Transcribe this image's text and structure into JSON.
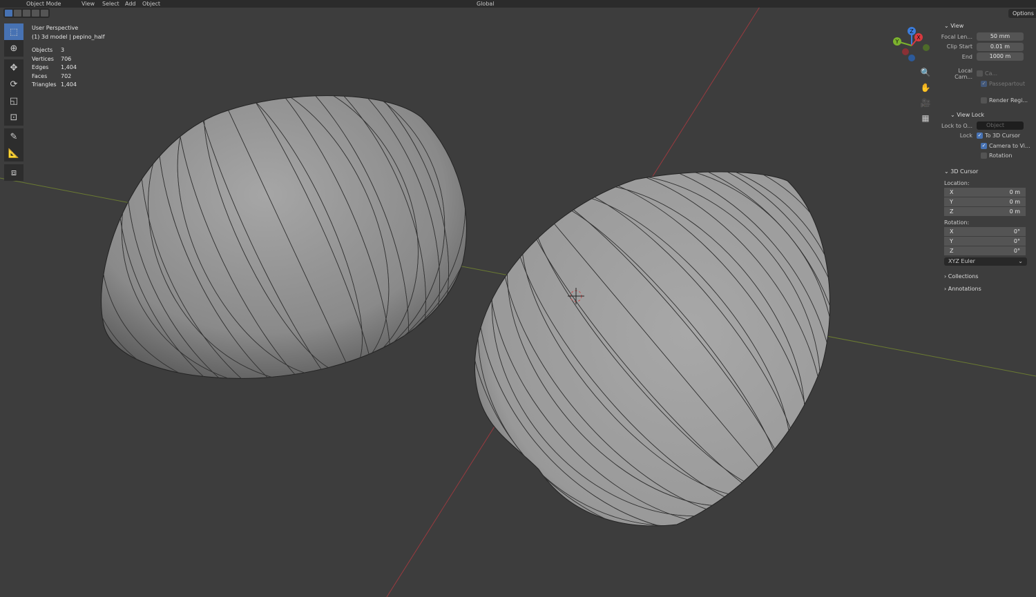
{
  "header": {
    "mode": "Object Mode",
    "menus": [
      "View",
      "Select",
      "Add",
      "Object"
    ],
    "orientation": "Global",
    "options_label": "Options"
  },
  "overlay": {
    "perspective": "User Perspective",
    "object_info": "(1) 3d model | pepino_half",
    "stats": [
      {
        "label": "Objects",
        "value": "3"
      },
      {
        "label": "Vertices",
        "value": "706"
      },
      {
        "label": "Edges",
        "value": "1,404"
      },
      {
        "label": "Faces",
        "value": "702"
      },
      {
        "label": "Triangles",
        "value": "1,404"
      }
    ]
  },
  "gizmo": {
    "x": "X",
    "y": "Y",
    "z": "Z"
  },
  "panel": {
    "view": {
      "title": "View",
      "focal_label": "Focal Len...",
      "focal": "50 mm",
      "clip_start_label": "Clip Start",
      "clip_start": "0.01 m",
      "end_label": "End",
      "end": "1000 m",
      "local_cam_label": "Local Cam...",
      "local_cam_value": "Ca...",
      "passepartout": "Passepartout",
      "render_region": "Render Regi..."
    },
    "view_lock": {
      "title": "View Lock",
      "lock_to_label": "Lock to O...",
      "lock_to_placeholder": "Object",
      "lock_label": "Lock",
      "to_cursor": "To 3D Cursor",
      "camera_to_view": "Camera to Vi...",
      "rotation": "Rotation"
    },
    "cursor": {
      "title": "3D Cursor",
      "location_label": "Location:",
      "loc": [
        {
          "axis": "X",
          "value": "0 m"
        },
        {
          "axis": "Y",
          "value": "0 m"
        },
        {
          "axis": "Z",
          "value": "0 m"
        }
      ],
      "rotation_label": "Rotation:",
      "rot": [
        {
          "axis": "X",
          "value": "0°"
        },
        {
          "axis": "Y",
          "value": "0°"
        },
        {
          "axis": "Z",
          "value": "0°"
        }
      ],
      "mode": "XYZ Euler"
    },
    "collections": "Collections",
    "annotations": "Annotations"
  }
}
